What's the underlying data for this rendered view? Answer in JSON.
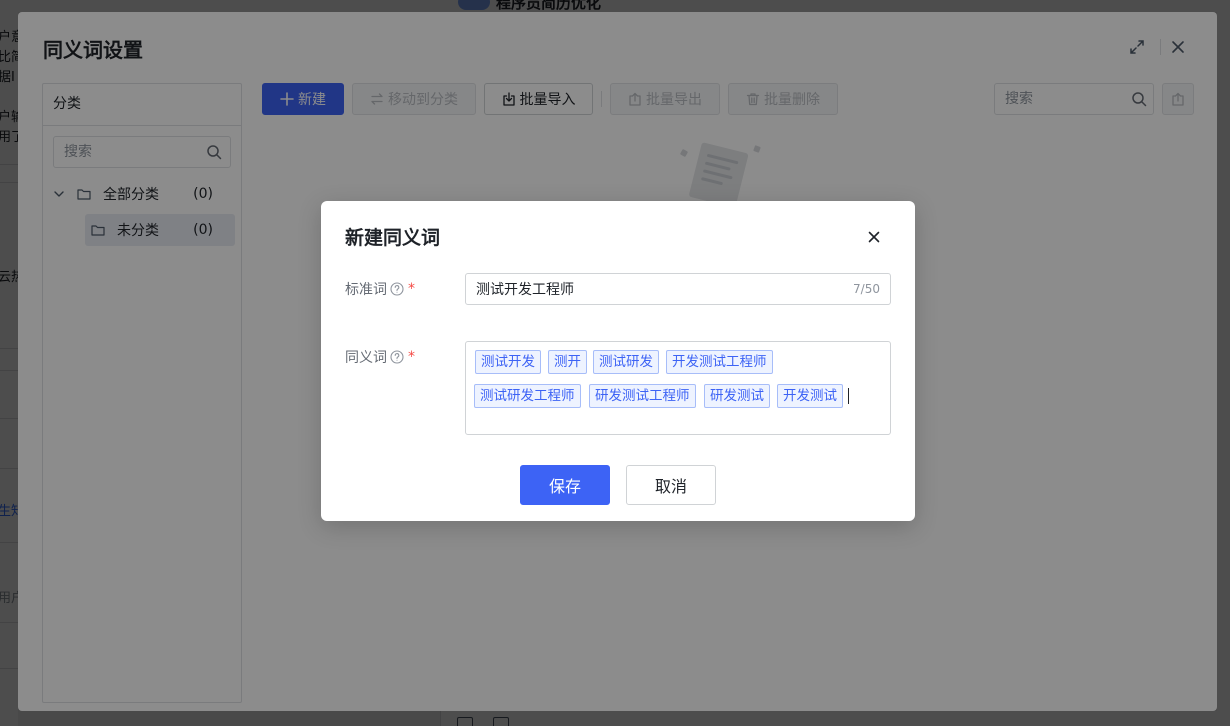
{
  "background": {
    "left_fragments": [
      "户意",
      "比简",
      "据I",
      "户输",
      "用了",
      "云热",
      "生知",
      "用户"
    ],
    "top_title": "程序员简历优化"
  },
  "dialog": {
    "title": "同义词设置",
    "category_panel": {
      "header": "分类",
      "search_placeholder": "搜索",
      "tree": [
        {
          "label": "全部分类",
          "count": "(0)"
        },
        {
          "label": "未分类",
          "count": "(0)"
        }
      ]
    },
    "toolbar": {
      "new_label": "新建",
      "move_label": "移动到分类",
      "import_label": "批量导入",
      "export_label": "批量导出",
      "delete_label": "批量删除",
      "search_placeholder": "搜索"
    }
  },
  "modal": {
    "title": "新建同义词",
    "standard_word": {
      "label": "标准词",
      "value": "测试开发工程师",
      "counter": "7/50"
    },
    "synonyms": {
      "label": "同义词",
      "tags": [
        "测试开发",
        "测开",
        "测试研发",
        "开发测试工程师",
        "测试研发工程师",
        "研发测试工程师",
        "研发测试",
        "开发测试"
      ]
    },
    "save_label": "保存",
    "cancel_label": "取消"
  },
  "colors": {
    "primary": "#3d63f5",
    "required": "#f54a45",
    "tag_bg": "#eef3ff",
    "tag_border": "#a7bdf9"
  }
}
